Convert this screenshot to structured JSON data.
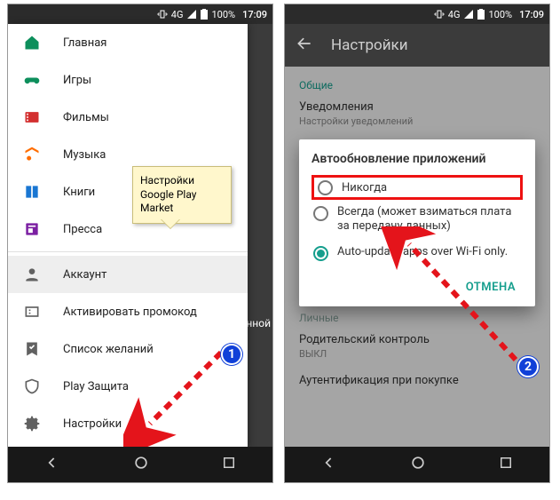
{
  "status": {
    "battery": "100%",
    "net": "4G",
    "time": "17:09"
  },
  "left": {
    "callout": "Настройки Google Play Market",
    "strip_text": "нной",
    "items": [
      {
        "name": "home",
        "label": "Главная",
        "color": "#0d8f5c"
      },
      {
        "name": "games",
        "label": "Игры",
        "color": "#0d8f5c"
      },
      {
        "name": "movies",
        "label": "Фильмы",
        "color": "#d32f2f"
      },
      {
        "name": "music",
        "label": "Музыка",
        "color": "#ff6d00"
      },
      {
        "name": "books",
        "label": "Книги",
        "color": "#1976d2"
      },
      {
        "name": "press",
        "label": "Пресса",
        "color": "#7b1fa2"
      },
      {
        "name": "account",
        "label": "Аккаунт",
        "color": "#616161",
        "selected": true
      },
      {
        "name": "promo",
        "label": "Активировать промокод",
        "color": "#616161"
      },
      {
        "name": "wishlist",
        "label": "Список желаний",
        "color": "#616161"
      },
      {
        "name": "protect",
        "label": "Play Защита",
        "color": "#616161"
      },
      {
        "name": "settings",
        "label": "Настройки",
        "color": "#616161"
      }
    ]
  },
  "right": {
    "appbar_title": "Настройки",
    "section_general": "Общие",
    "notif_label": "Уведомления",
    "notif_sub": "Настройки уведомлений",
    "section_personal": "Личные",
    "parental": "Родительский контроль",
    "parental_state": "ВЫКЛ",
    "auth_purchase": "Аутентификация при покупке",
    "dialog": {
      "title": "Автообновление приложений",
      "opt_never": "Никогда",
      "opt_always": "Всегда (может взиматься плата за передачу данных)",
      "opt_wifi": "Auto-update apps over Wi-Fi only.",
      "cancel": "ОТМЕНА"
    }
  }
}
